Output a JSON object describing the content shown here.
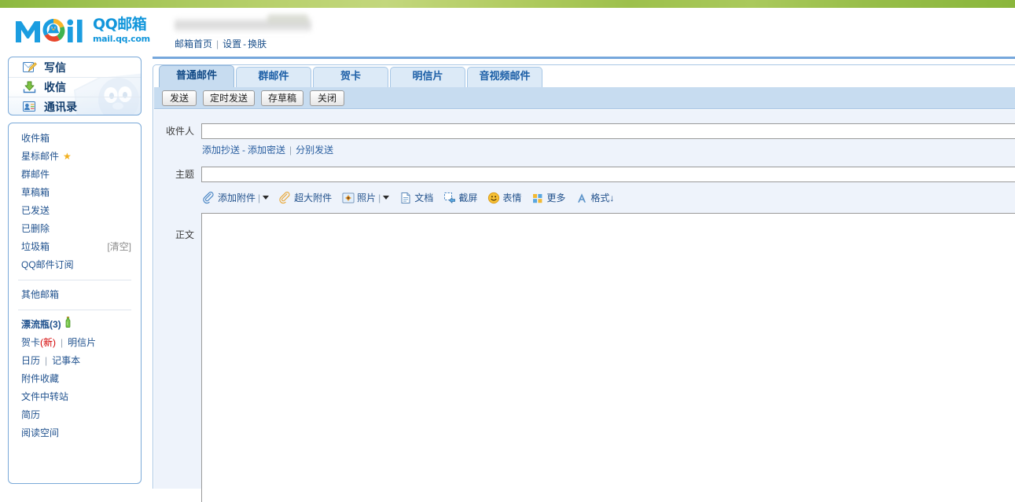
{
  "header": {
    "logo_alt": "Mail",
    "brand_cn": "QQ邮箱",
    "brand_url": "mail.qq.com",
    "username_redacted": "",
    "nav": {
      "home": "邮箱首页",
      "separator": "|",
      "settings": "设置",
      "dash": "-",
      "skin": "换肤"
    },
    "colors": {
      "top_bar_green": "#9dc04c",
      "brand_blue": "#1296db",
      "link_blue": "#1a4f8a"
    }
  },
  "sidebar": {
    "actions": [
      {
        "label": "写信",
        "icon": "compose-icon"
      },
      {
        "label": "收信",
        "icon": "inbox-download-icon"
      },
      {
        "label": "通讯录",
        "icon": "contacts-icon"
      }
    ],
    "folders": [
      {
        "label": "收件箱"
      },
      {
        "label": "星标邮件",
        "star": "★"
      },
      {
        "label": "群邮件"
      },
      {
        "label": "草稿箱"
      },
      {
        "label": "已发送"
      },
      {
        "label": "已删除"
      },
      {
        "label": "垃圾箱",
        "action": "[清空]"
      },
      {
        "label": "QQ邮件订阅"
      }
    ],
    "other": {
      "label": "其他邮箱"
    },
    "extras": [
      {
        "label": "漂流瓶(3)",
        "bold": true,
        "icon": "bottle-icon"
      },
      {
        "label": "贺卡",
        "badge": "(新)",
        "sep": "|",
        "label2": "明信片"
      },
      {
        "label": "日历",
        "sep": "|",
        "label2": "记事本"
      },
      {
        "label": "附件收藏"
      },
      {
        "label": "文件中转站"
      },
      {
        "label": "简历"
      },
      {
        "label": "阅读空间"
      }
    ]
  },
  "main": {
    "tabs": [
      {
        "label": "普通邮件",
        "active": true
      },
      {
        "label": "群邮件",
        "active": false
      },
      {
        "label": "贺卡",
        "active": false
      },
      {
        "label": "明信片",
        "active": false
      },
      {
        "label": "音视频邮件",
        "active": false
      }
    ],
    "commands": [
      {
        "label": "发送"
      },
      {
        "label": "定时发送"
      },
      {
        "label": "存草稿"
      },
      {
        "label": "关闭"
      }
    ],
    "form": {
      "to_label": "收件人",
      "to_value": "",
      "to_placeholder": "",
      "cc_add": "添加抄送",
      "cc_dash": "-",
      "bcc_add": "添加密送",
      "cc_pipe": "|",
      "send_separately": "分别发送",
      "subject_label": "主题",
      "subject_value": "",
      "subject_placeholder": "",
      "body_label": "正文",
      "body_value": ""
    },
    "attach_toolbar": [
      {
        "label": "添加附件",
        "icon": "paperclip-icon",
        "has_caret": true,
        "bar": "|"
      },
      {
        "label": "超大附件",
        "icon": "paperclip-orange-icon",
        "has_caret": false
      },
      {
        "label": "照片",
        "icon": "photo-icon",
        "has_caret": true,
        "bar": "|"
      },
      {
        "label": "文档",
        "icon": "document-icon",
        "has_caret": false
      },
      {
        "label": "截屏",
        "icon": "screenshot-icon",
        "has_caret": false
      },
      {
        "label": "表情",
        "icon": "smiley-icon",
        "has_caret": false
      },
      {
        "label": "更多",
        "icon": "grid-more-icon",
        "has_caret": false
      },
      {
        "label": "格式↓",
        "icon": "format-A-icon",
        "has_caret": false
      }
    ]
  }
}
